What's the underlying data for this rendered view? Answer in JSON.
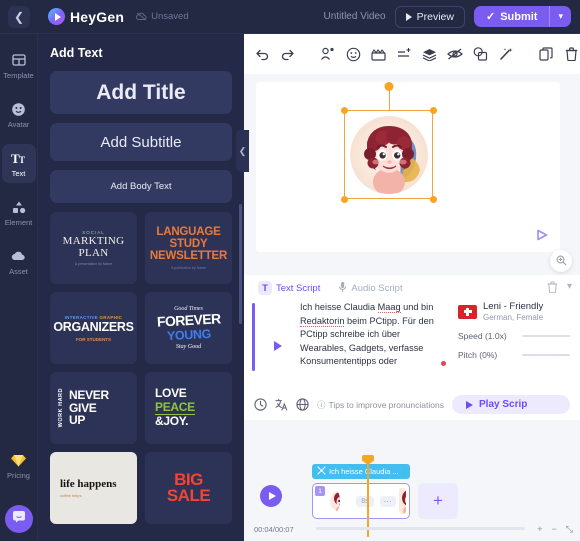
{
  "topbar": {
    "back_icon": "chevron-left-icon",
    "brand": "HeyGen",
    "save_status": "Unsaved",
    "video_title": "Untitled Video",
    "preview_label": "Preview",
    "submit_label": "Submit",
    "submit_caret": "⌄"
  },
  "rail": {
    "items": [
      {
        "label": "Template",
        "icon": "template-icon",
        "active": false
      },
      {
        "label": "Avatar",
        "icon": "avatar-icon",
        "active": false
      },
      {
        "label": "Text",
        "icon": "text-icon",
        "active": true
      },
      {
        "label": "Element",
        "icon": "element-icon",
        "active": false
      },
      {
        "label": "Asset",
        "icon": "asset-cloud-icon",
        "active": false
      }
    ],
    "pricing_label": "Pricing",
    "pricing_icon": "diamond-icon",
    "chat_icon": "chat-bubble-icon"
  },
  "panel": {
    "title": "Add Text",
    "add_title": "Add Title",
    "add_subtitle": "Add Subtitle",
    "add_body": "Add Body Text",
    "collapse_icon": "chevron-left-icon",
    "templates": [
      {
        "id": "marketing-plan",
        "kicker": "SOCIAL",
        "main": "MARKTING PLAN",
        "sub": "A presentation by Name"
      },
      {
        "id": "language-study",
        "l1": "LANGUAGE",
        "l2": "STUDY",
        "l3": "NEWSLETTER",
        "sub": "A publication by Name"
      },
      {
        "id": "graphic-organizers",
        "top_a": "INTERACTIVE",
        "top_b": "GRAPHIC",
        "main": "ORGANIZERS",
        "bottom": "FOR STUDENTS"
      },
      {
        "id": "forever-young",
        "top": "Good Times",
        "mid": "FOREVER",
        "blue": "YOUNG",
        "bottom": "Stay Good"
      },
      {
        "id": "never-give-up",
        "vertical": "WORK HARD",
        "l1": "NEVER",
        "l2": "GIVE",
        "l3": "UP"
      },
      {
        "id": "love-peace-joy",
        "l1": "LOVE",
        "l2": "PEACE",
        "l3": "&JOY."
      },
      {
        "id": "life-happens",
        "main": "life happens",
        "sub": "coffee helps"
      },
      {
        "id": "big-sale",
        "l1": "BIG",
        "l2": "SALE"
      }
    ]
  },
  "tools": [
    {
      "name": "undo-icon"
    },
    {
      "name": "redo-icon"
    },
    {
      "name": "avatar-swap-icon"
    },
    {
      "name": "emoji-icon"
    },
    {
      "name": "clapperboard-icon"
    },
    {
      "name": "add-element-icon"
    },
    {
      "name": "layers-icon"
    },
    {
      "name": "hide-eye-icon"
    },
    {
      "name": "shapes-icon"
    },
    {
      "name": "magic-wand-icon"
    },
    {
      "name": "duplicate-icon"
    },
    {
      "name": "delete-icon"
    }
  ],
  "canvas": {
    "logo_icon": "heygen-watermark-icon",
    "zoom_icon": "zoom-in-icon",
    "avatar_name": "curly-red-hair-cartoon-avatar"
  },
  "script": {
    "tab_text": "Text Script",
    "tab_audio": "Audio Script",
    "delete_icon": "trash-icon",
    "collapse_icon": "chevron-down-icon",
    "text_part1": "Ich heisse Claudia ",
    "text_err1": "Maag",
    "text_part2": " und bin ",
    "text_err2": "Redaktorin",
    "text_part3": " beim PCtipp. Für den PCtipp schreibe ich über Wearables, Gadgets, verfasse Konsumententipps oder",
    "voice_name": "Leni - Friendly",
    "voice_meta": "German, Female",
    "voice_flag": "swiss-flag-icon",
    "speed_label": "Speed (1.0x)",
    "pitch_label": "Pitch (0%)",
    "foot_icons": [
      "clock-icon",
      "translate-icon",
      "globe-icon"
    ],
    "tips_label": "Tips to improve pronunciations",
    "play_script_label": "Play Scrip"
  },
  "timeline": {
    "play_icon": "play-circle-icon",
    "caption_icon": "caption-icon",
    "caption_label": "Ich heisse Claudia ...",
    "scene_number": "1",
    "scene_duration": "8s",
    "scene_more": "···",
    "add_label": "+",
    "time_display": "00:04/00:07",
    "ctrl_zoom_in": "+",
    "ctrl_zoom_out": "−",
    "ctrl_fit": "⤡"
  }
}
